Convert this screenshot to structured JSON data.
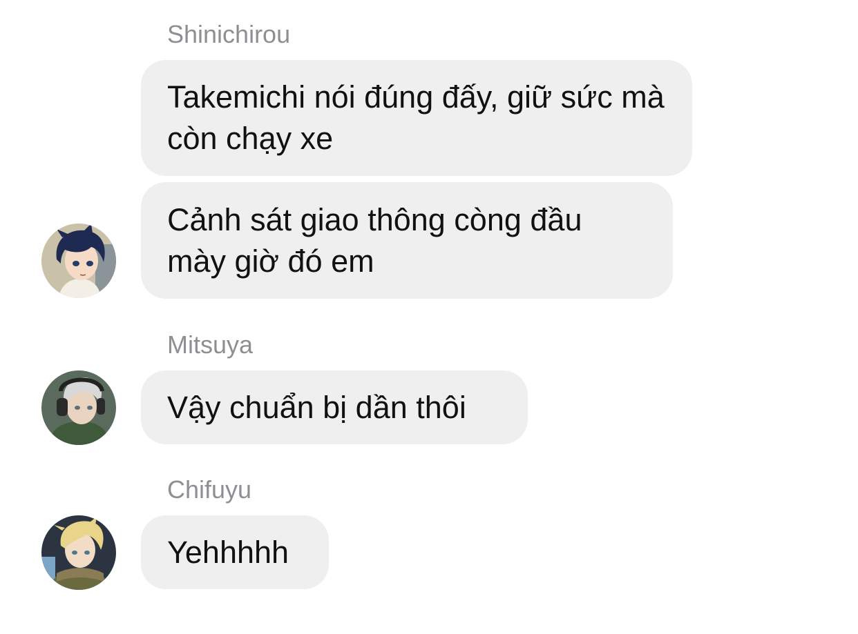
{
  "messages": [
    {
      "sender": "Shinichirou",
      "bubbles": [
        "Takemichi nói đúng đấy, giữ sức mà còn chạy xe",
        "Cảnh sát giao thông còng đầu mày giờ đó em"
      ],
      "avatar_icon": "anime-boy-dark-blue-hair-avatar"
    },
    {
      "sender": "Mitsuya",
      "bubbles": [
        "Vậy chuẩn bị dần thôi"
      ],
      "avatar_icon": "anime-boy-silver-hair-headphones-avatar"
    },
    {
      "sender": "Chifuyu",
      "bubbles": [
        "Yehhhhh"
      ],
      "avatar_icon": "anime-boy-blonde-hair-avatar"
    }
  ],
  "colors": {
    "bubble_background": "#efefef",
    "sender_name": "#8e8e93",
    "message_text": "#111111"
  }
}
